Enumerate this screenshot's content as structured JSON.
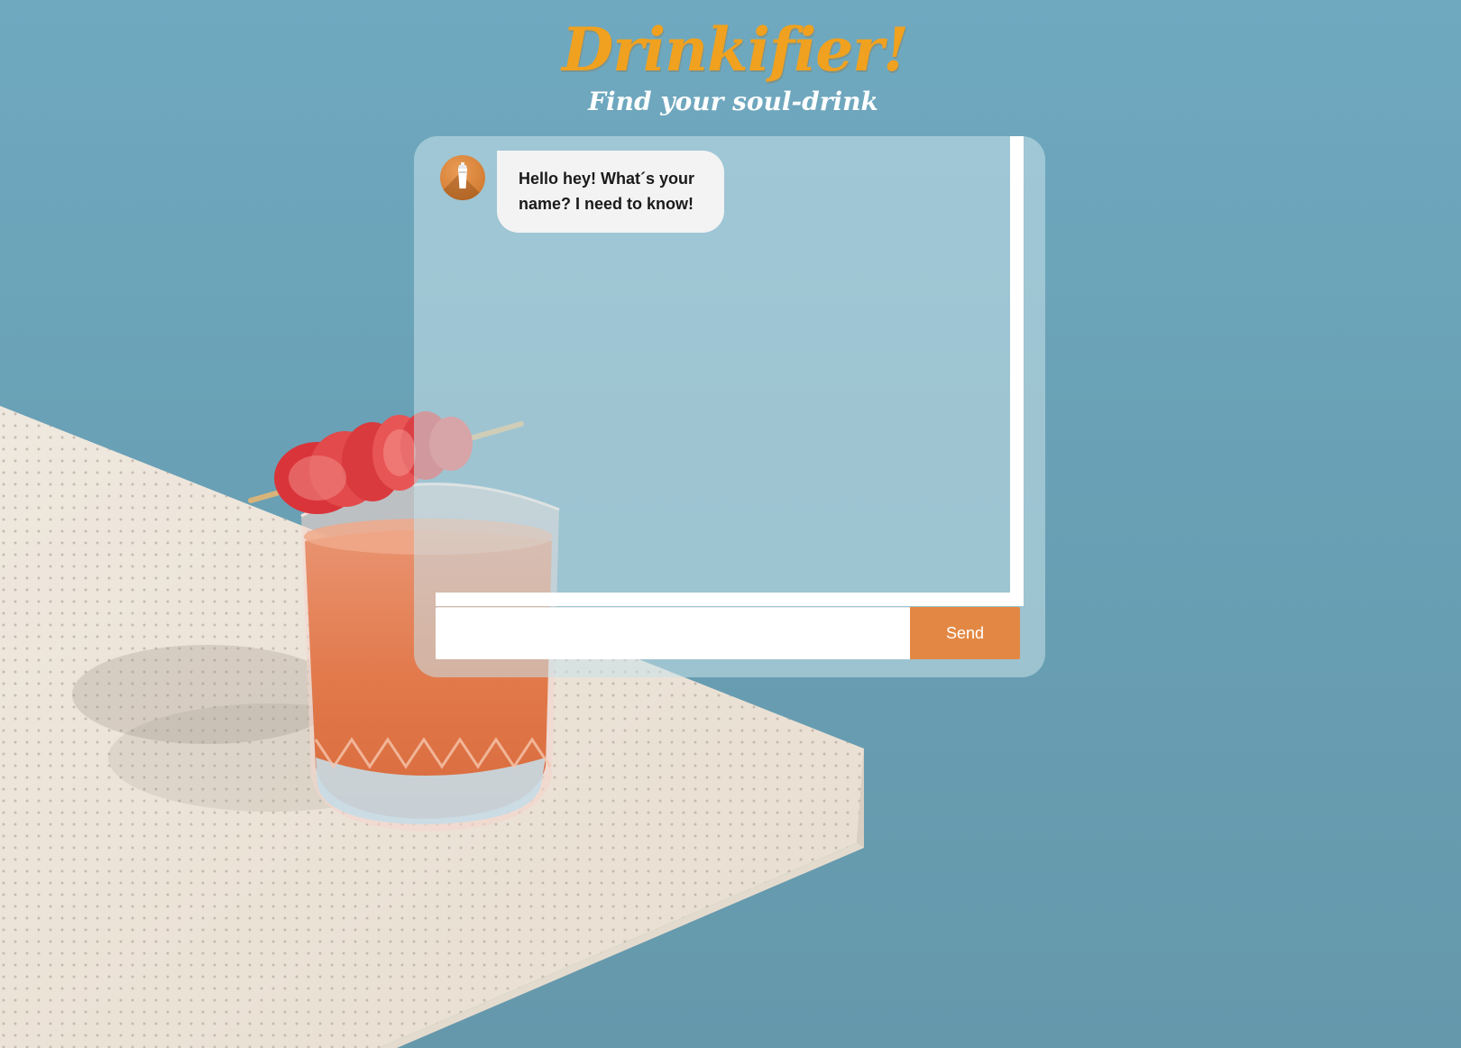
{
  "header": {
    "title": "Drinkifier!",
    "subtitle": "Find your soul-drink"
  },
  "chat": {
    "messages": [
      {
        "sender": "bot",
        "avatar_icon": "cocktail-shaker-icon",
        "text": "Hello hey! What´s your name? I need to know!"
      }
    ],
    "input": {
      "value": "",
      "placeholder": ""
    },
    "send_label": "Send"
  },
  "colors": {
    "title": "#f0a11f",
    "accent": "#e38844",
    "background": "#6aa1b6",
    "bubble": "#f3f3f3"
  },
  "background_image": {
    "icons": [
      "table-image",
      "cocktail-glass-image",
      "strawberry-garnish-image"
    ]
  }
}
